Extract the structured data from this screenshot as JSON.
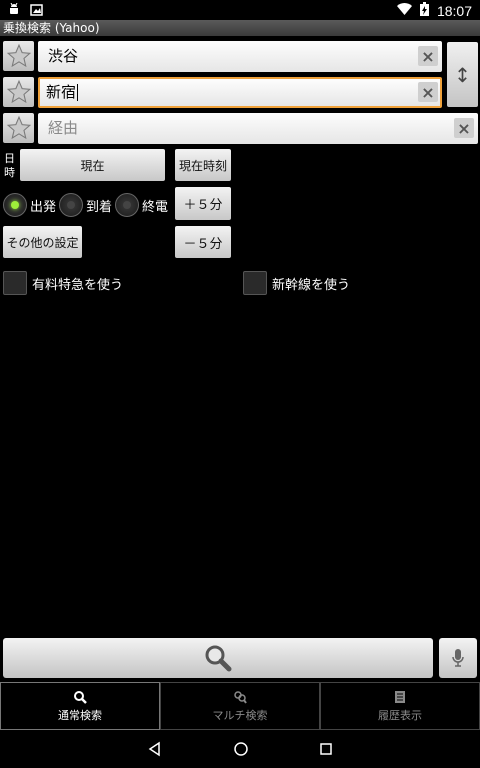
{
  "status_bar": {
    "left_icons": [
      "android-debug-icon",
      "photo-notification-icon"
    ],
    "right_icons": [
      "wifi-icon",
      "battery-icon"
    ],
    "time": "18:07"
  },
  "app": {
    "title": "乗換検索 (Yahoo)"
  },
  "route": {
    "from": {
      "value": "渋谷"
    },
    "to": {
      "value": "新宿"
    },
    "via": {
      "placeholder": "経由"
    }
  },
  "datetime": {
    "label": "日時",
    "current_label": "現在",
    "now_time_label": "現在時刻",
    "plus5_label": "＋５分",
    "minus5_label": "－５分"
  },
  "search_type": {
    "options": [
      {
        "label": "出発",
        "selected": true
      },
      {
        "label": "到着",
        "selected": false
      },
      {
        "label": "終電",
        "selected": false
      }
    ]
  },
  "other_settings_label": "その他の設定",
  "options": {
    "limited_express": {
      "label": "有料特急を使う",
      "checked": false
    },
    "shinkansen": {
      "label": "新幹線を使う",
      "checked": false
    }
  },
  "bottom_tabs": [
    {
      "label": "通常検索",
      "icon": "search-icon",
      "active": true
    },
    {
      "label": "マルチ検索",
      "icon": "multi-search-icon",
      "active": false
    },
    {
      "label": "履歴表示",
      "icon": "history-icon",
      "active": false
    }
  ],
  "colors": {
    "focus": "#f0a23b",
    "radio_on": "#9ef03a"
  }
}
